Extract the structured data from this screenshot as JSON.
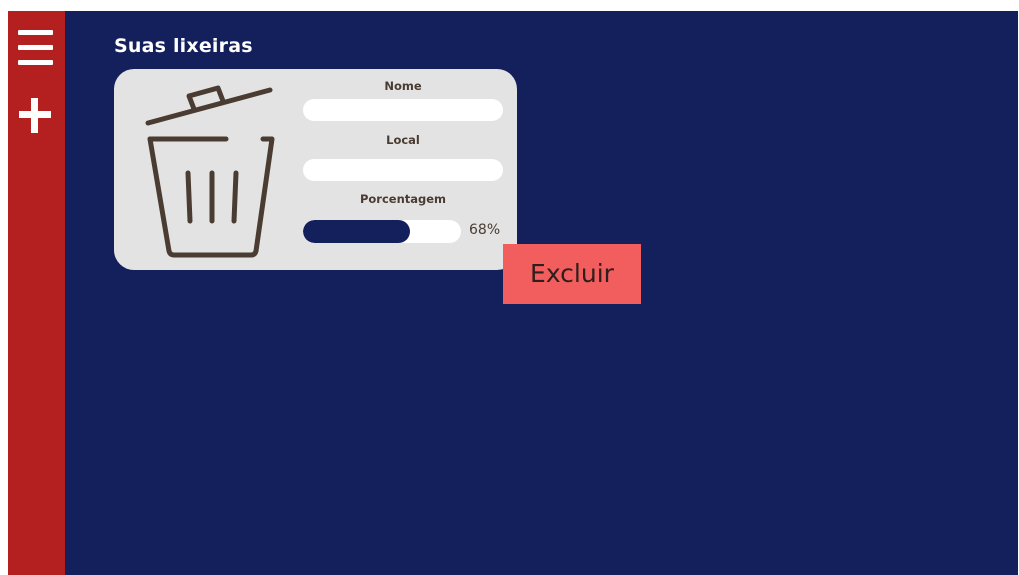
{
  "colors": {
    "background": "#13205c",
    "sidebar": "#b3201f",
    "card": "#e3e3e3",
    "text_brown": "#4a3c32",
    "delete_button": "#f25d5d",
    "progress_fill": "#13205c"
  },
  "sidebar": {
    "menu_icon": "hamburger-menu-icon",
    "add_icon": "plus-icon"
  },
  "page": {
    "title": "Suas lixeiras"
  },
  "bin_card": {
    "icon": "trash-bin-icon",
    "name_label": "Nome",
    "name_value": "",
    "location_label": "Local",
    "location_value": "",
    "percentage_label": "Porcentagem",
    "percentage_value": 68,
    "percentage_text": "68%"
  },
  "actions": {
    "delete_label": "Excluir"
  }
}
